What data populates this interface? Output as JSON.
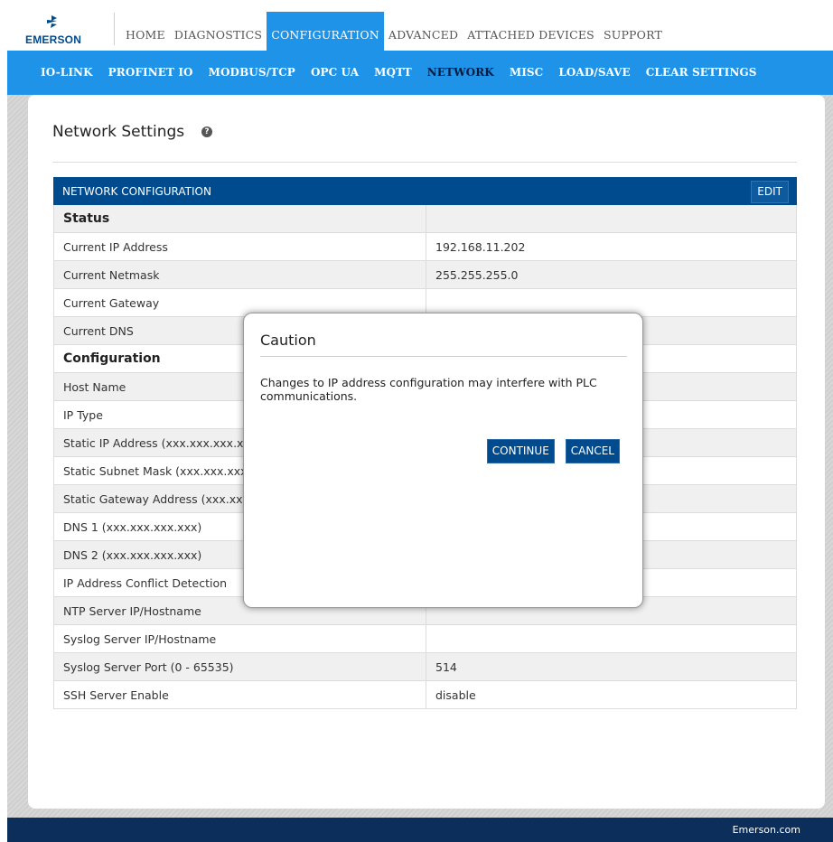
{
  "brand": {
    "logo_text": "EMERSON",
    "logo_icon": "emerson-mark-icon"
  },
  "topnav": [
    {
      "label": "HOME",
      "active": false
    },
    {
      "label": "DIAGNOSTICS",
      "active": false
    },
    {
      "label": "CONFIGURATION",
      "active": true
    },
    {
      "label": "ADVANCED",
      "active": false
    },
    {
      "label": "ATTACHED DEVICES",
      "active": false
    },
    {
      "label": "SUPPORT",
      "active": false
    }
  ],
  "subnav": [
    {
      "label": "IO-LINK",
      "active": false
    },
    {
      "label": "PROFINET IO",
      "active": false
    },
    {
      "label": "MODBUS/TCP",
      "active": false
    },
    {
      "label": "OPC UA",
      "active": false
    },
    {
      "label": "MQTT",
      "active": false
    },
    {
      "label": "NETWORK",
      "active": true
    },
    {
      "label": "MISC",
      "active": false
    },
    {
      "label": "LOAD/SAVE",
      "active": false
    },
    {
      "label": "CLEAR SETTINGS",
      "active": false
    }
  ],
  "page": {
    "title": "Network Settings",
    "help_icon": "help-icon"
  },
  "table": {
    "header": "NETWORK CONFIGURATION",
    "edit_label": "EDIT",
    "rows": [
      {
        "key": "Status",
        "value": "",
        "section": true
      },
      {
        "key": "Current IP Address",
        "value": "192.168.11.202"
      },
      {
        "key": "Current Netmask",
        "value": "255.255.255.0"
      },
      {
        "key": "Current Gateway",
        "value": ""
      },
      {
        "key": "Current DNS",
        "value": ""
      },
      {
        "key": "Configuration",
        "value": "",
        "section": true
      },
      {
        "key": "Host Name",
        "value": ""
      },
      {
        "key": "IP Type",
        "value": ""
      },
      {
        "key": "Static IP Address (xxx.xxx.xxx.xx",
        "value": ""
      },
      {
        "key": "Static Subnet Mask (xxx.xxx.xxx.:",
        "value": ""
      },
      {
        "key": "Static Gateway Address (xxx.xxx",
        "value": ""
      },
      {
        "key": "DNS 1 (xxx.xxx.xxx.xxx)",
        "value": ""
      },
      {
        "key": "DNS 2 (xxx.xxx.xxx.xxx)",
        "value": ""
      },
      {
        "key": "IP Address Conflict Detection",
        "value": ""
      },
      {
        "key": "NTP Server IP/Hostname",
        "value": ""
      },
      {
        "key": "Syslog Server IP/Hostname",
        "value": ""
      },
      {
        "key": "Syslog Server Port (0 - 65535)",
        "value": "514"
      },
      {
        "key": "SSH Server Enable",
        "value": "disable"
      }
    ]
  },
  "modal": {
    "title": "Caution",
    "message": "Changes to IP address configuration may interfere with PLC communications.",
    "continue_label": "CONTINUE",
    "cancel_label": "CANCEL"
  },
  "footer": {
    "text": "Emerson.com"
  }
}
